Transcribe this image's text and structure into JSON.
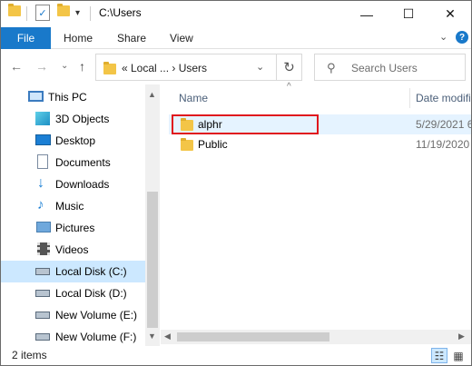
{
  "window": {
    "title": "C:\\Users",
    "minimize_glyph": "—",
    "maximize_glyph": "☐",
    "close_glyph": "✕"
  },
  "ribbon": {
    "file": "File",
    "tabs": [
      "Home",
      "Share",
      "View"
    ],
    "collapse_glyph": "⌄",
    "help_glyph": "?"
  },
  "nav": {
    "back_glyph": "←",
    "forward_glyph": "→",
    "recent_glyph": "⌄",
    "up_glyph": "↑",
    "address_text": "« Local ...  ›  Users",
    "address_dropdown_glyph": "⌄",
    "refresh_glyph": "↻",
    "search_icon_glyph": "⚲",
    "search_placeholder": "Search Users"
  },
  "sidebar": {
    "items": [
      {
        "label": "This PC",
        "icon": "this-pc-icon",
        "selected": false
      },
      {
        "label": "3D Objects",
        "icon": "3d-objects-icon",
        "selected": false
      },
      {
        "label": "Desktop",
        "icon": "desktop-icon",
        "selected": false
      },
      {
        "label": "Documents",
        "icon": "documents-icon",
        "selected": false
      },
      {
        "label": "Downloads",
        "icon": "downloads-icon",
        "selected": false
      },
      {
        "label": "Music",
        "icon": "music-icon",
        "selected": false
      },
      {
        "label": "Pictures",
        "icon": "pictures-icon",
        "selected": false
      },
      {
        "label": "Videos",
        "icon": "videos-icon",
        "selected": false
      },
      {
        "label": "Local Disk (C:)",
        "icon": "local-disk-icon",
        "selected": true
      },
      {
        "label": "Local Disk (D:)",
        "icon": "local-disk-icon",
        "selected": false
      },
      {
        "label": "New Volume (E:)",
        "icon": "new-volume-icon",
        "selected": false
      },
      {
        "label": "New Volume (F:)",
        "icon": "new-volume-icon",
        "selected": false
      }
    ]
  },
  "content": {
    "columns": {
      "name": "Name",
      "date": "Date modifi"
    },
    "sort_arrow_glyph": "^",
    "rows": [
      {
        "name": "alphr",
        "date": "5/29/2021 6",
        "selected": true,
        "icon": "folder-icon"
      },
      {
        "name": "Public",
        "date": "11/19/2020",
        "selected": false,
        "icon": "folder-icon"
      }
    ]
  },
  "status": {
    "item_count": "2 items",
    "details_view_glyph": "☷",
    "tiles_view_glyph": "▦"
  },
  "colors": {
    "accent": "#1979ca",
    "selection": "#cce8ff",
    "highlight_box": "#e0161d",
    "folder": "#f3c547"
  }
}
